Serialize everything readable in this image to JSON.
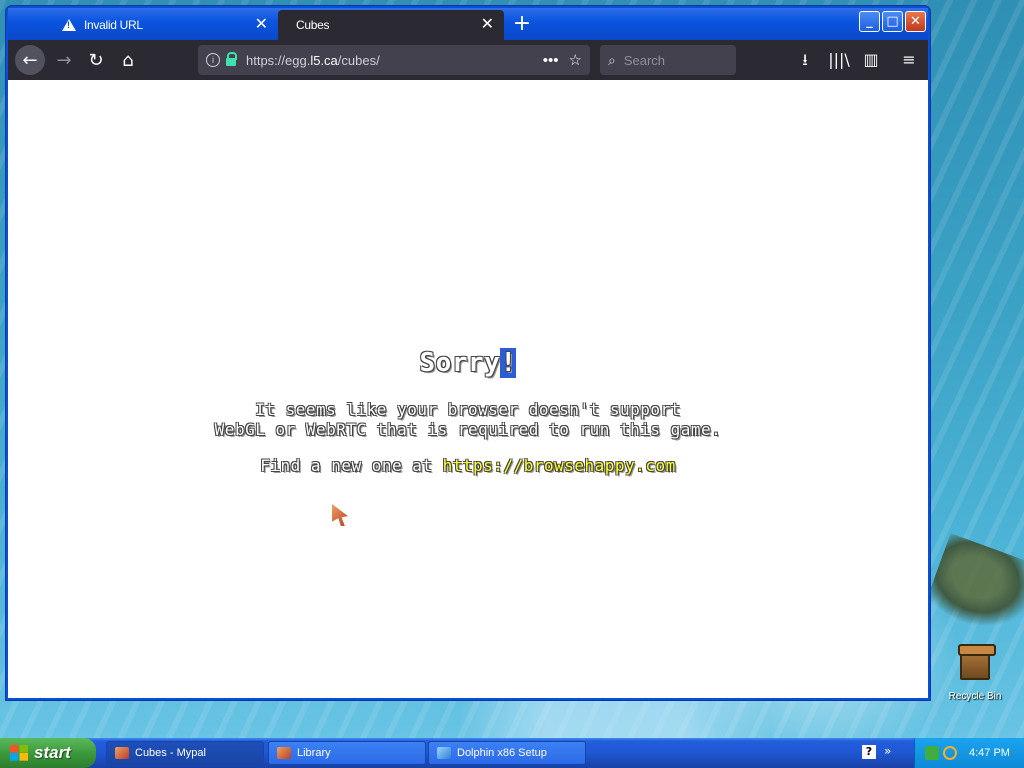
{
  "window": {
    "tabs": [
      {
        "title": "Invalid URL",
        "icon": "warning-icon"
      },
      {
        "title": "Cubes",
        "icon": ""
      }
    ],
    "new_tab": "+",
    "controls": {
      "min": "_",
      "max": "□",
      "close": "✕"
    }
  },
  "toolbar": {
    "url_prefix": "https://egg.",
    "url_host": "l5.ca",
    "url_path": "/cubes/",
    "page_actions": "•••",
    "search_placeholder": "Search"
  },
  "page": {
    "title_main": "Sorry",
    "title_highlight": "!",
    "line1": "It seems like your browser doesn't support",
    "line2": "WebGL or WebRTC that is required to run this game.",
    "line3_prefix": "Find a new one at ",
    "line3_link": "https://browsehappy.com"
  },
  "desktop": {
    "recycle_bin": "Recycle Bin"
  },
  "taskbar": {
    "start": "start",
    "tasks": [
      "Cubes - Mypal",
      "Library",
      "Dolphin x86 Setup"
    ],
    "help": "?",
    "clock": "4:47 PM"
  },
  "colors": {
    "accent": "#0b55e0",
    "link": "#ffff33",
    "highlight": "#2b5ed6"
  }
}
